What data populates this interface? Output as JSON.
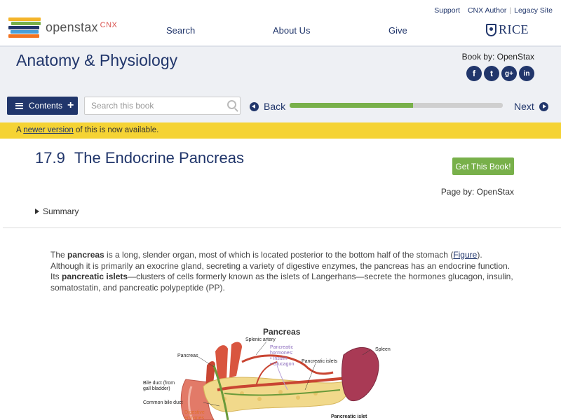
{
  "header": {
    "logo_text": "openstax",
    "logo_suffix": "CNX",
    "util_links": [
      "Support",
      "CNX Author",
      "Legacy Site"
    ],
    "nav": [
      "Search",
      "About Us",
      "Give"
    ],
    "partner": "RICE"
  },
  "book": {
    "title": "Anatomy & Physiology",
    "by": "Book by: OpenStax",
    "social": [
      "f",
      "t",
      "g+",
      "in"
    ]
  },
  "toolbar": {
    "contents_label": "Contents",
    "search_placeholder": "Search this book",
    "back_label": "Back",
    "next_label": "Next",
    "progress_fraction": 0.58
  },
  "banner": {
    "prefix": "A ",
    "link": "newer version",
    "suffix": " of this is now available."
  },
  "module": {
    "number": "17.9",
    "title": "The Endocrine Pancreas",
    "get_book": "Get This Book!",
    "page_by": "Page by: OpenStax",
    "summary": "Summary"
  },
  "paragraph": {
    "t1": "The ",
    "b1": "pancreas",
    "t2": " is a long, slender organ, most of which is located posterior to the bottom half of the stomach (",
    "link": "Figure",
    "t3": "). Although it is primarily an exocrine gland, secreting a variety of digestive enzymes, the pancreas has an endocrine function. Its ",
    "b2": "pancreatic islets",
    "t4": "—clusters of cells formerly known as the islets of Langerhans—secrete the hormones glucagon, insulin, somatostatin, and pancreatic polypeptide (PP)."
  },
  "figure": {
    "title": "Pancreas",
    "labels": {
      "splenic_artery": "Splenic artery",
      "hormones_title": "Pancreatic hormones:",
      "hormone_1": "• Insulin",
      "hormone_2": "• Glucagon",
      "pancreatic_islets": "Pancreatic islets",
      "spleen": "Spleen",
      "pancreas": "Pancreas",
      "bile_duct": "Bile duct (from gall bladder)",
      "common_bile_duct": "Common bile duct",
      "digestive": "Digestive enzymes",
      "pancreatic_islet": "Pancreatic islet"
    }
  },
  "colors": {
    "navy": "#21366b",
    "green": "#78b04a",
    "banner_yellow": "#f5d334",
    "cnx_red": "#d9534f"
  }
}
